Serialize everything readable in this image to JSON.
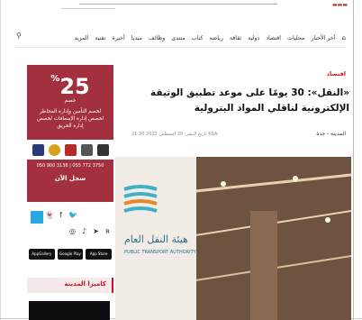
{
  "header": {
    "nav_items": [
      "آخر الأخبار",
      "محليات",
      "اقتصاد",
      "دولية",
      "ثقافة",
      "رياضة",
      "كتاب",
      "منتدى",
      "وظائف",
      "ميديا",
      "أخيرة",
      "تقنية",
      "المزيد"
    ]
  },
  "article": {
    "section": "اقتصاد",
    "title": "«النقل»: 30 يومًا على موعد تطبيق الوثيقة الإلكترونية لناقلي المواد البترولية",
    "location": "المدينة - جدة",
    "published": "تاريخ النشر: 20 أغسطس 2022 21:30 KSA"
  },
  "ad": {
    "percent": "25",
    "percent_sign": "%",
    "off_label": "خصم",
    "text": "لخصم التأمين وإدارة المخاطر لخصص إدارة الإسعافات لخصص إدارة الحريق",
    "phones": "050 900 3136 | 055 772 3750",
    "cta": "سجل الآن"
  },
  "sidebar": {
    "camera_title": "كاميرا المدينة",
    "store_badges": [
      "AppGallery",
      "Google Play",
      "App Store"
    ]
  },
  "icons": [
    "home-icon",
    "search-icon",
    "twitter-icon",
    "facebook-icon",
    "snapchat-icon",
    "youtube-icon",
    "instagram-icon",
    "telegram-icon",
    "tiktok-icon",
    "rss-icon"
  ]
}
